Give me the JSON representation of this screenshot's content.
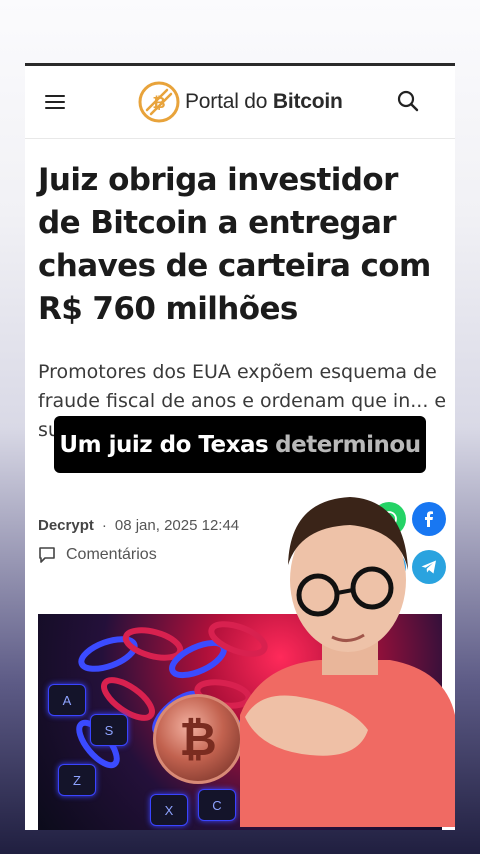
{
  "site": {
    "logo_text_light": "Portal do ",
    "logo_text_bold": "Bitcoin",
    "accent": "#e8a33b"
  },
  "header_icons": {
    "menu": "menu-icon",
    "search": "search-icon"
  },
  "article": {
    "headline": "Juiz obriga investidor de Bitcoin a entregar chaves de carteira com R$ 760 milhões",
    "subtitle": "Promotores dos EUA expõem esquema de fraude fiscal de anos e ordenam que in... e su...",
    "author": "Decrypt",
    "separator": "·",
    "date": "08 jan, 2025 12:44",
    "comments_label": "Comentários"
  },
  "share_buttons": [
    {
      "name": "whatsapp-icon",
      "color": "#25d366"
    },
    {
      "name": "facebook-icon",
      "color": "#1877f2"
    },
    {
      "name": "twitter-icon",
      "color": "#1da1f2"
    },
    {
      "name": "telegram-icon",
      "color": "#2aa3df"
    }
  ],
  "image_keys": [
    "A",
    "S",
    "Z",
    "X",
    "C"
  ],
  "video_caption": {
    "bright": "Um juiz do Texas",
    "dim": "determinou"
  }
}
